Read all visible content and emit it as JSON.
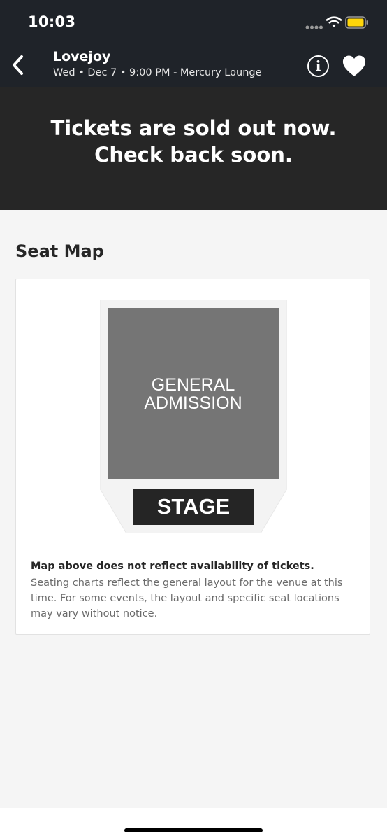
{
  "status_bar": {
    "time": "10:03"
  },
  "header": {
    "title": "Lovejoy",
    "subtitle": "Wed • Dec 7 • 9:00 PM - Mercury Lounge",
    "info_icon_glyph": "i"
  },
  "banner": {
    "message": "Tickets are sold out now. Check back soon."
  },
  "seat_map": {
    "section_title": "Seat Map",
    "general_admission_label": "GENERAL\nADMISSION",
    "stage_label": "STAGE",
    "disclaimer_title": "Map above does not reflect availability of tickets.",
    "disclaimer_body": "Seating charts reflect the general layout for the venue at this time. For some events, the layout and specific seat locations may vary without notice."
  },
  "icons": {
    "back": "chevron-left-icon",
    "info": "info-icon",
    "favorite": "heart-icon",
    "wifi": "wifi-icon",
    "battery": "battery-icon",
    "signal": "cellular-signal-icon"
  },
  "colors": {
    "header_background": "#1f2329",
    "banner_background": "#262626",
    "page_background": "#f5f5f5",
    "general_admission_fill": "#757575",
    "stage_fill": "#252525",
    "battery_fill": "#ffd60a"
  }
}
